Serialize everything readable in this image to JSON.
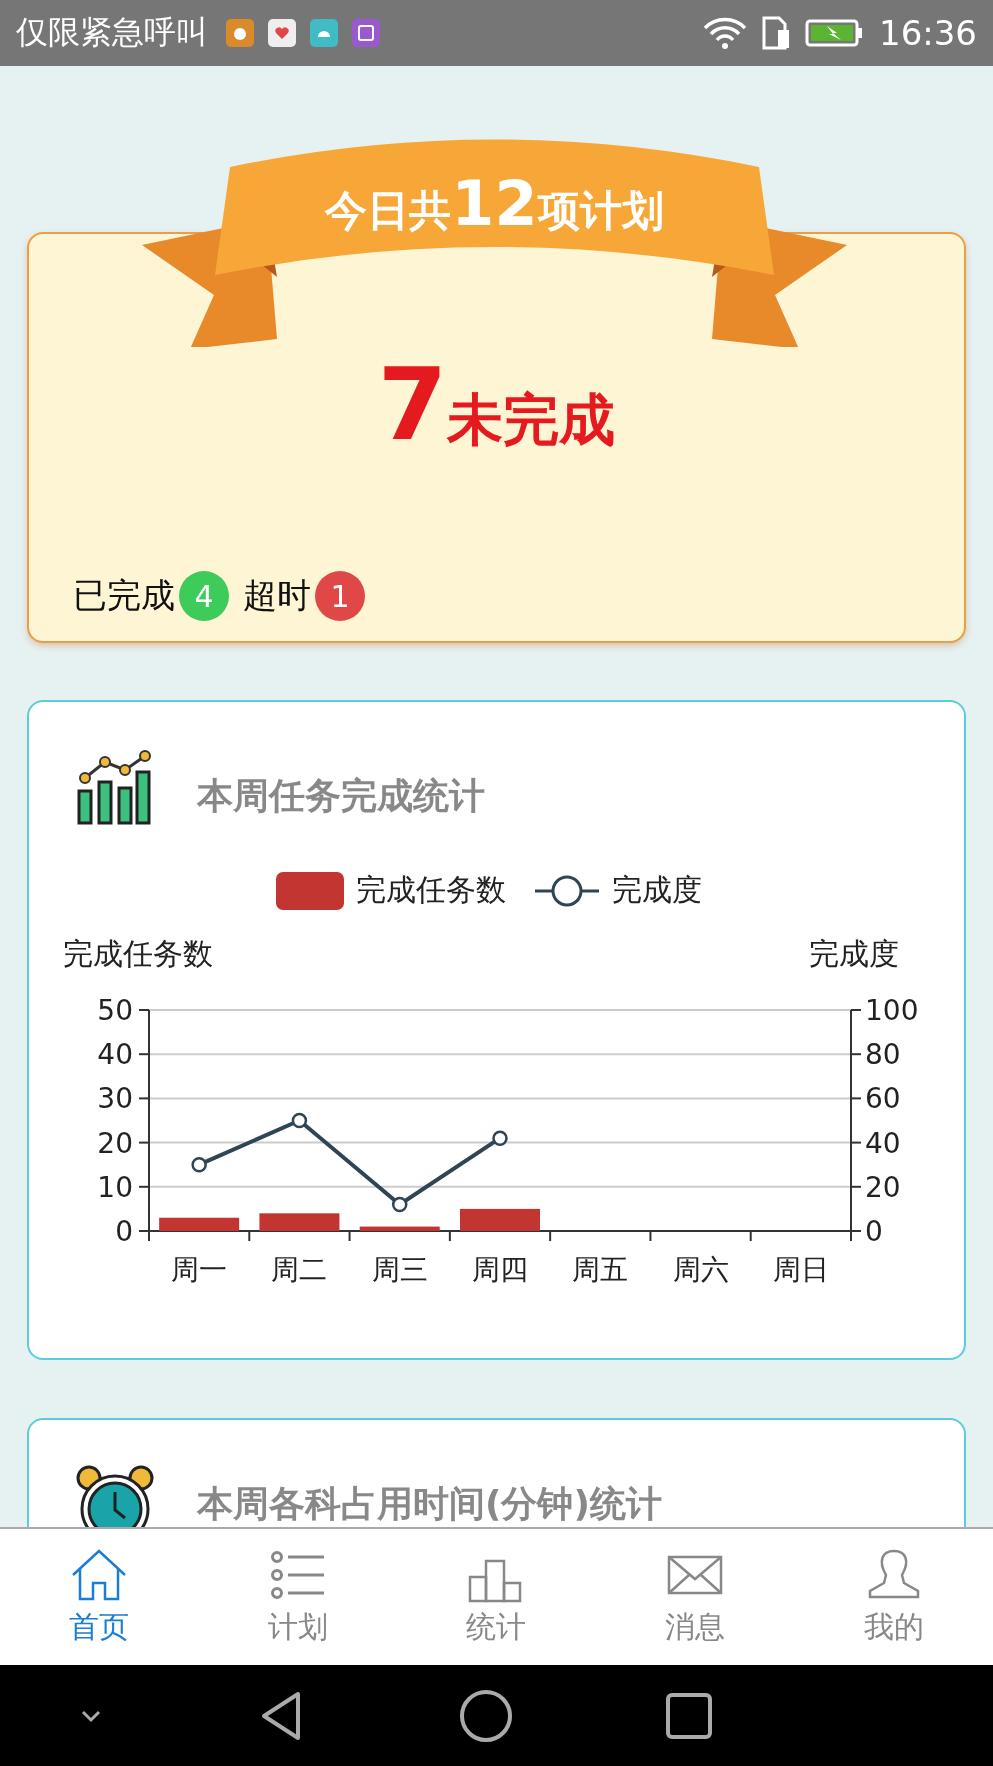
{
  "status_bar": {
    "carrier": "仅限紧急呼叫",
    "time": "16:36"
  },
  "plan_card": {
    "prefix": "今日共",
    "total": "12",
    "suffix": "项计划",
    "pending_count": "7",
    "pending_label": "未完成",
    "counters": [
      {
        "label": "已完成",
        "count": "4",
        "color": "#3dcc5a"
      },
      {
        "label": "超时",
        "count": "1",
        "color": "#e04848"
      }
    ]
  },
  "task_card": {
    "title": "本周任务完成统计",
    "chart_data": {
      "type": "bar",
      "ylabel": "完成任务数",
      "y2label": "完成度",
      "categories": [
        "周一",
        "周二",
        "周三",
        "周四",
        "周五",
        "周六",
        "周日"
      ],
      "ylim": [
        0,
        50
      ],
      "yticks": [
        0,
        10,
        20,
        30,
        40,
        50
      ],
      "y2lim": [
        0,
        100
      ],
      "y2ticks": [
        0,
        20,
        40,
        60,
        80,
        100
      ],
      "grid": true,
      "legend": "top",
      "series": [
        {
          "name": "完成任务数",
          "color": "#c23531",
          "values": [
            3,
            4,
            1,
            5,
            null,
            null,
            null
          ]
        },
        {
          "name": "完成度",
          "type": "line",
          "axis": "y2",
          "marker": "circle",
          "color": "#2f4554",
          "values": [
            30,
            50,
            12,
            42,
            null,
            null,
            null
          ]
        }
      ]
    }
  },
  "time_card": {
    "title": "本周各科占用时间(分钟)统计"
  },
  "tab_bar": [
    {
      "kind": "home",
      "label": "首页",
      "selected": true
    },
    {
      "kind": "list",
      "label": "计划",
      "selected": false
    },
    {
      "kind": "podium",
      "label": "统计",
      "selected": false
    },
    {
      "kind": "mail",
      "label": "消息",
      "selected": false
    },
    {
      "kind": "person",
      "label": "我的",
      "selected": false
    }
  ]
}
